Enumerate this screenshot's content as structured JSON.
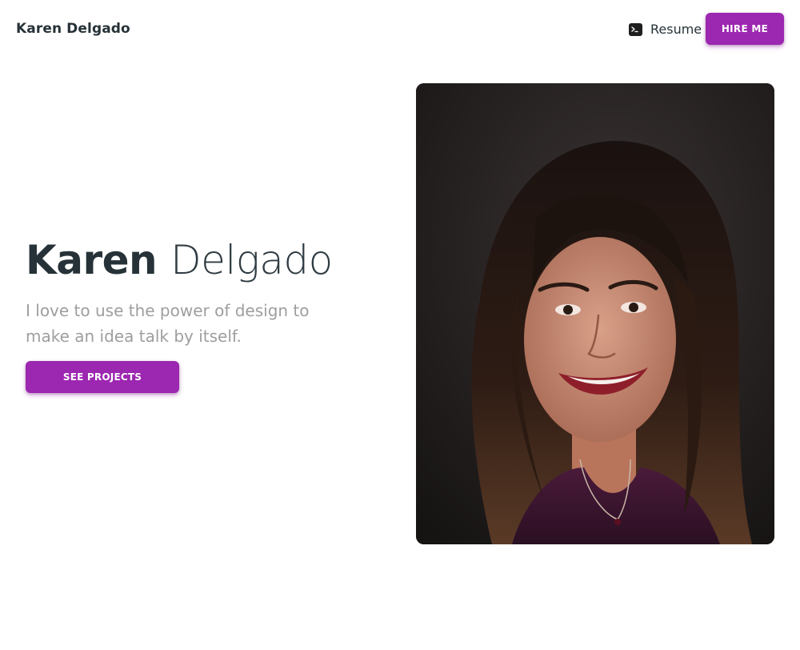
{
  "header": {
    "brand": "Karen Delgado",
    "resume_icon": "terminal-icon",
    "resume_label": "Resume",
    "hire_label": "HIRE ME"
  },
  "hero": {
    "first_name": "Karen",
    "last_name": "Delgado",
    "tagline": "I love to use the power of design to make an idea talk by itself.",
    "cta_label": "SEE PROJECTS"
  },
  "colors": {
    "accent": "#9c27b0",
    "text_dark": "#263238",
    "text_muted": "#9e9e9e",
    "background": "#ffffff"
  }
}
